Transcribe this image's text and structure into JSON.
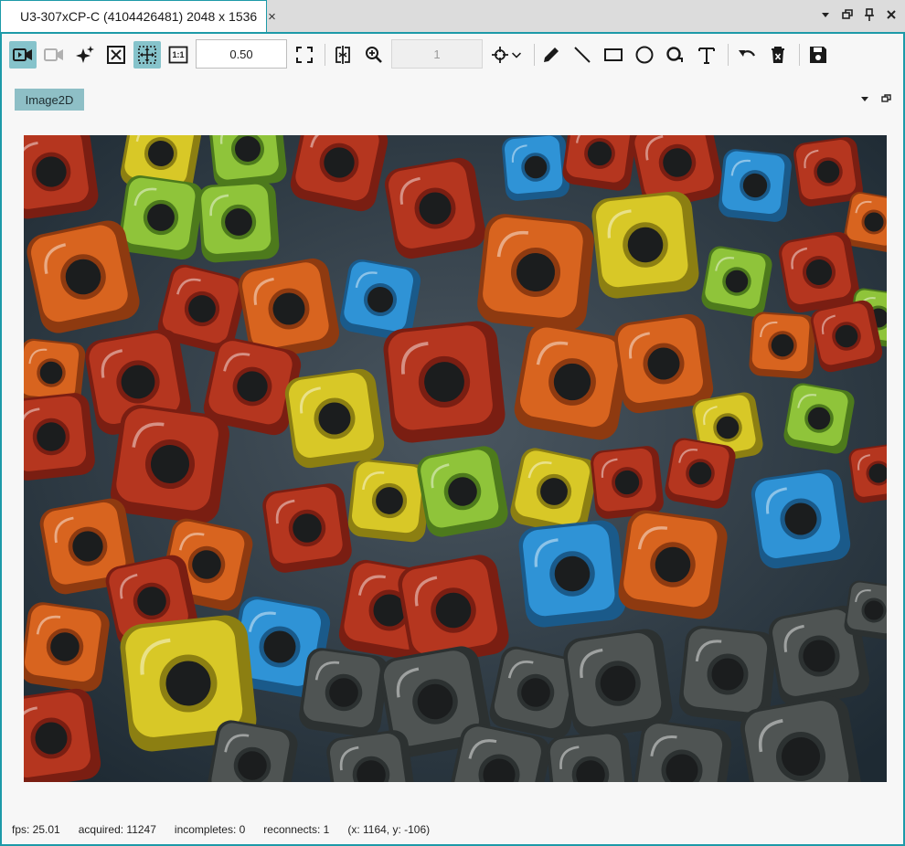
{
  "document_tab": {
    "icon": "video-camera-icon",
    "title": "U3-307xCP-C (4104426481) 2048 x 1536",
    "close_glyph": "×"
  },
  "tabbar_controls": [
    "dropdown-icon",
    "restore-icon",
    "pin-icon",
    "close-icon"
  ],
  "toolbar": {
    "buttons": [
      {
        "name": "live-video-button",
        "icon": "video-play-icon",
        "active": true
      },
      {
        "name": "snapshot-camera-button",
        "icon": "camera-disabled-icon",
        "active": false
      },
      {
        "name": "auto-adjust-button",
        "icon": "sparkle-icon",
        "active": false
      },
      {
        "name": "fit-crosshair-button",
        "icon": "crossed-box-icon",
        "active": false
      },
      {
        "name": "fit-to-window-button",
        "icon": "move-arrows-icon",
        "active": true
      },
      {
        "name": "actual-size-button",
        "icon": "one-to-one-icon",
        "label": "1:1",
        "active": false
      }
    ],
    "zoom_value": "0.50",
    "frame_value": "1"
  },
  "inner_tab": {
    "label": "Image2D"
  },
  "status": {
    "fps": "fps: 25.01",
    "acquired": "acquired: 11247",
    "incompletes": "incompletes: 0",
    "reconnects": "reconnects: 1",
    "cursor": "(x: 1164, y: -106)"
  },
  "colors": {
    "accent": "#1d9aa8",
    "active_button": "#86c3cb",
    "inner_tab": "#8ebfc6"
  }
}
